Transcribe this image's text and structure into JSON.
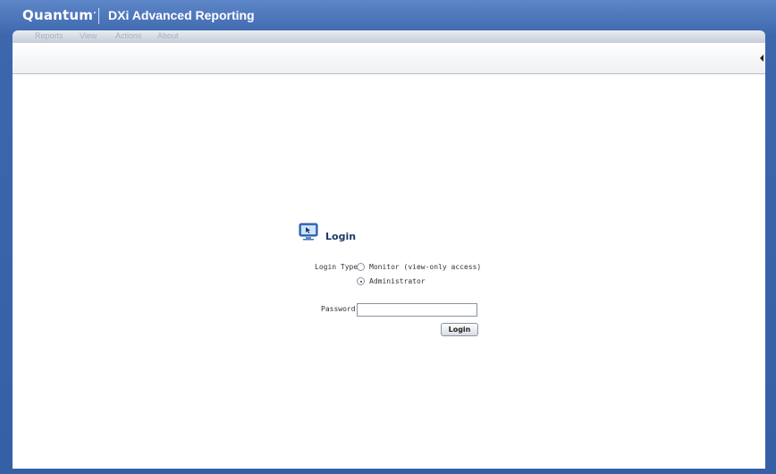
{
  "header": {
    "brand": "Quantum",
    "brand_mark": ".",
    "product_title": "DXi Advanced Reporting"
  },
  "menu": {
    "items": [
      {
        "label": "Reports"
      },
      {
        "label": "View"
      },
      {
        "label": "Actions"
      },
      {
        "label": "About"
      }
    ]
  },
  "login": {
    "title": "Login",
    "icon": "monitor-cursor-icon",
    "login_type_label": "Login Type:",
    "options": [
      {
        "label": "Monitor (view-only access)",
        "selected": false
      },
      {
        "label": "Administrator",
        "selected": true
      }
    ],
    "password_label": "Password:",
    "password_value": "",
    "button_label": "Login"
  },
  "colors": {
    "frame_blue": "#3d64a8",
    "title_text": "#1d3a66",
    "content_bg": "#ffffff"
  }
}
